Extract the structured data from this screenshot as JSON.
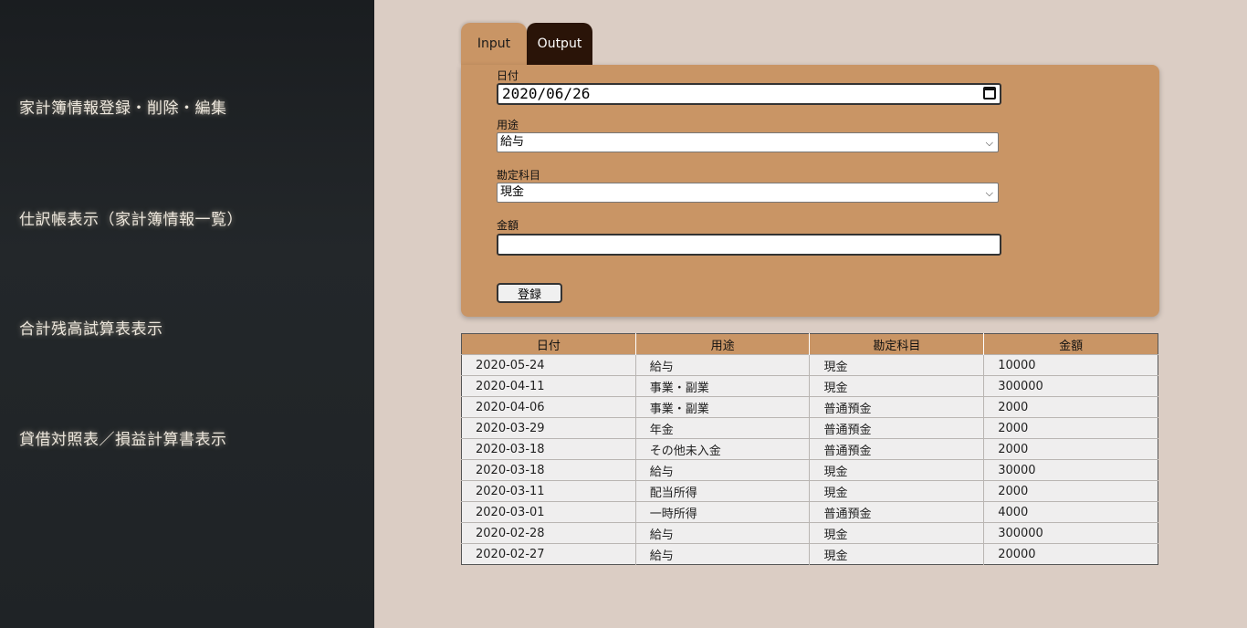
{
  "sidebar": {
    "items": [
      {
        "label": "家計簿情報登録・削除・編集"
      },
      {
        "label": "仕訳帳表示（家計簿情報一覧）"
      },
      {
        "label": "合計残高試算表表示"
      },
      {
        "label": "貸借対照表／損益計算書表示"
      }
    ]
  },
  "tabs": {
    "input": "Input",
    "output": "Output"
  },
  "form": {
    "date_label": "日付",
    "date_value": "2020/06/26",
    "usage_label": "用途",
    "usage_value": "給与",
    "account_label": "勘定科目",
    "account_value": "現金",
    "amount_label": "金額",
    "amount_value": "",
    "submit_label": "登録"
  },
  "table": {
    "headers": [
      "日付",
      "用途",
      "勘定科目",
      "金額"
    ],
    "rows": [
      [
        "2020-05-24",
        "給与",
        "現金",
        "10000"
      ],
      [
        "2020-04-11",
        "事業・副業",
        "現金",
        "300000"
      ],
      [
        "2020-04-06",
        "事業・副業",
        "普通預金",
        "2000"
      ],
      [
        "2020-03-29",
        "年金",
        "普通預金",
        "2000"
      ],
      [
        "2020-03-18",
        "その他未入金",
        "普通預金",
        "2000"
      ],
      [
        "2020-03-18",
        "給与",
        "現金",
        "30000"
      ],
      [
        "2020-03-11",
        "配当所得",
        "現金",
        "2000"
      ],
      [
        "2020-03-01",
        "一時所得",
        "普通預金",
        "4000"
      ],
      [
        "2020-02-28",
        "給与",
        "現金",
        "300000"
      ],
      [
        "2020-02-27",
        "給与",
        "現金",
        "20000"
      ]
    ]
  },
  "colors": {
    "accent": "#c99565",
    "sidebar_bg": "#1f2326",
    "page_bg": "#dbcdc4",
    "output_tab": "#2a1408"
  }
}
